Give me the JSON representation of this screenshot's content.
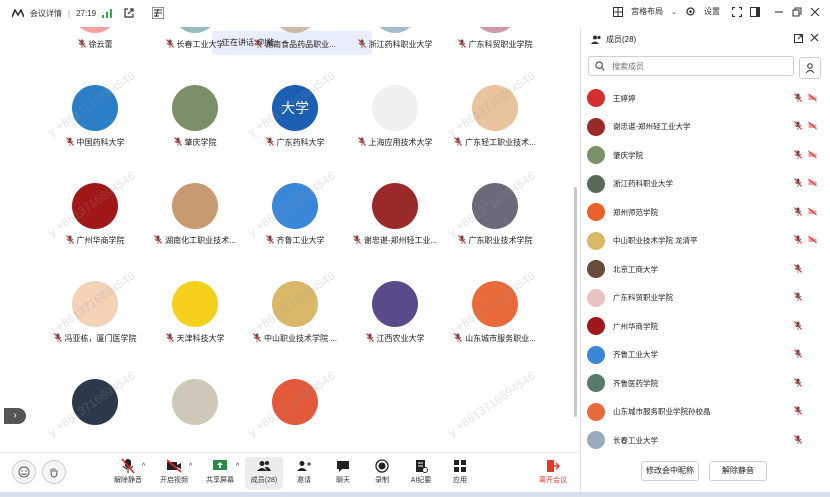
{
  "topbar": {
    "title": "会议详情",
    "timer": "27:19",
    "layout_label": "宫格布局",
    "settings_label": "设置"
  },
  "speaking": "正在讲话: 刘能;",
  "watermark": "y +8613716694546",
  "grid": [
    {
      "label": "徐云蕾",
      "avatar": "#f3a0a0"
    },
    {
      "label": "长春工业大学",
      "avatar": "#9bb"
    },
    {
      "label": "湖南食品药品职业...",
      "avatar": "#cba"
    },
    {
      "label": "浙江药科职业大学",
      "avatar": "#abc"
    },
    {
      "label": "广东科贸职业学院",
      "avatar": "#c9a"
    },
    {
      "label": "中国药科大学",
      "avatar": "#2b7fc7"
    },
    {
      "label": "肇庆学院",
      "avatar": "#7a8f6a"
    },
    {
      "label": "广东药科大学",
      "avatar": "#1a5fb4",
      "avatar_text": "大学"
    },
    {
      "label": "上海应用技术大学",
      "avatar": "#f0f0f0"
    },
    {
      "label": "广东轻工职业技术...",
      "avatar": "#e9c39b"
    },
    {
      "label": "广州华商学院",
      "avatar": "#a01818"
    },
    {
      "label": "湖南化工职业技术...",
      "avatar": "#c89a72"
    },
    {
      "label": "齐鲁工业大学",
      "avatar": "#3a86d8"
    },
    {
      "label": "谢忠谌-郑州轻工业...",
      "avatar": "#9a2a2a"
    },
    {
      "label": "广东职业技术学院",
      "avatar": "#6a6a7a"
    },
    {
      "label": "冯亚栋，厦门医学院",
      "avatar": "#f3d2b8"
    },
    {
      "label": "天津科技大学",
      "avatar": "#f4d01c"
    },
    {
      "label": "中山职业技术学院 ...",
      "avatar": "#d9b86a"
    },
    {
      "label": "江西农业大学",
      "avatar": "#5a4a8a"
    },
    {
      "label": "山东城市服务职业...",
      "avatar": "#e86a3a"
    },
    {
      "label": "",
      "avatar": "#2a3a4a"
    },
    {
      "label": "",
      "avatar": "#cfc8b8"
    },
    {
      "label": "",
      "avatar": "#e35a3a"
    }
  ],
  "toolbar": {
    "unmute": "解除静音",
    "video": "开启视频",
    "share": "共享屏幕",
    "members": "成员(28)",
    "invite": "邀请",
    "chat": "聊天",
    "record": "录制",
    "ai": "AI纪要",
    "apps": "应用",
    "leave": "离开会议"
  },
  "panel": {
    "title": "成员(28)",
    "search_placeholder": "搜索成员",
    "members": [
      {
        "name": "王婷婷",
        "avatar": "#d03030"
      },
      {
        "name": "谢忠谌-郑州轻工业大学",
        "avatar": "#9a2a2a"
      },
      {
        "name": "肇庆学院",
        "avatar": "#7a8f6a"
      },
      {
        "name": "浙江药科职业大学",
        "avatar": "#5a6a5a"
      },
      {
        "name": "郑州师范学院",
        "avatar": "#e8602a"
      },
      {
        "name": "中山职业技术学院 龙清平",
        "avatar": "#d9b86a"
      },
      {
        "name": "北京工商大学",
        "avatar": "#6a4a3a"
      },
      {
        "name": "广东科贸职业学院",
        "avatar": "#e9c3c3"
      },
      {
        "name": "广州华商学院",
        "avatar": "#a01818"
      },
      {
        "name": "齐鲁工业大学",
        "avatar": "#3a86d8"
      },
      {
        "name": "齐鲁医药学院",
        "avatar": "#5a7a6a"
      },
      {
        "name": "山东城市服务职业学院孙校晶",
        "avatar": "#e86a3a"
      },
      {
        "name": "长春工业大学",
        "avatar": "#9ab"
      }
    ],
    "rename_btn": "修改会中昵称",
    "unmute_all_btn": "解除静音"
  }
}
